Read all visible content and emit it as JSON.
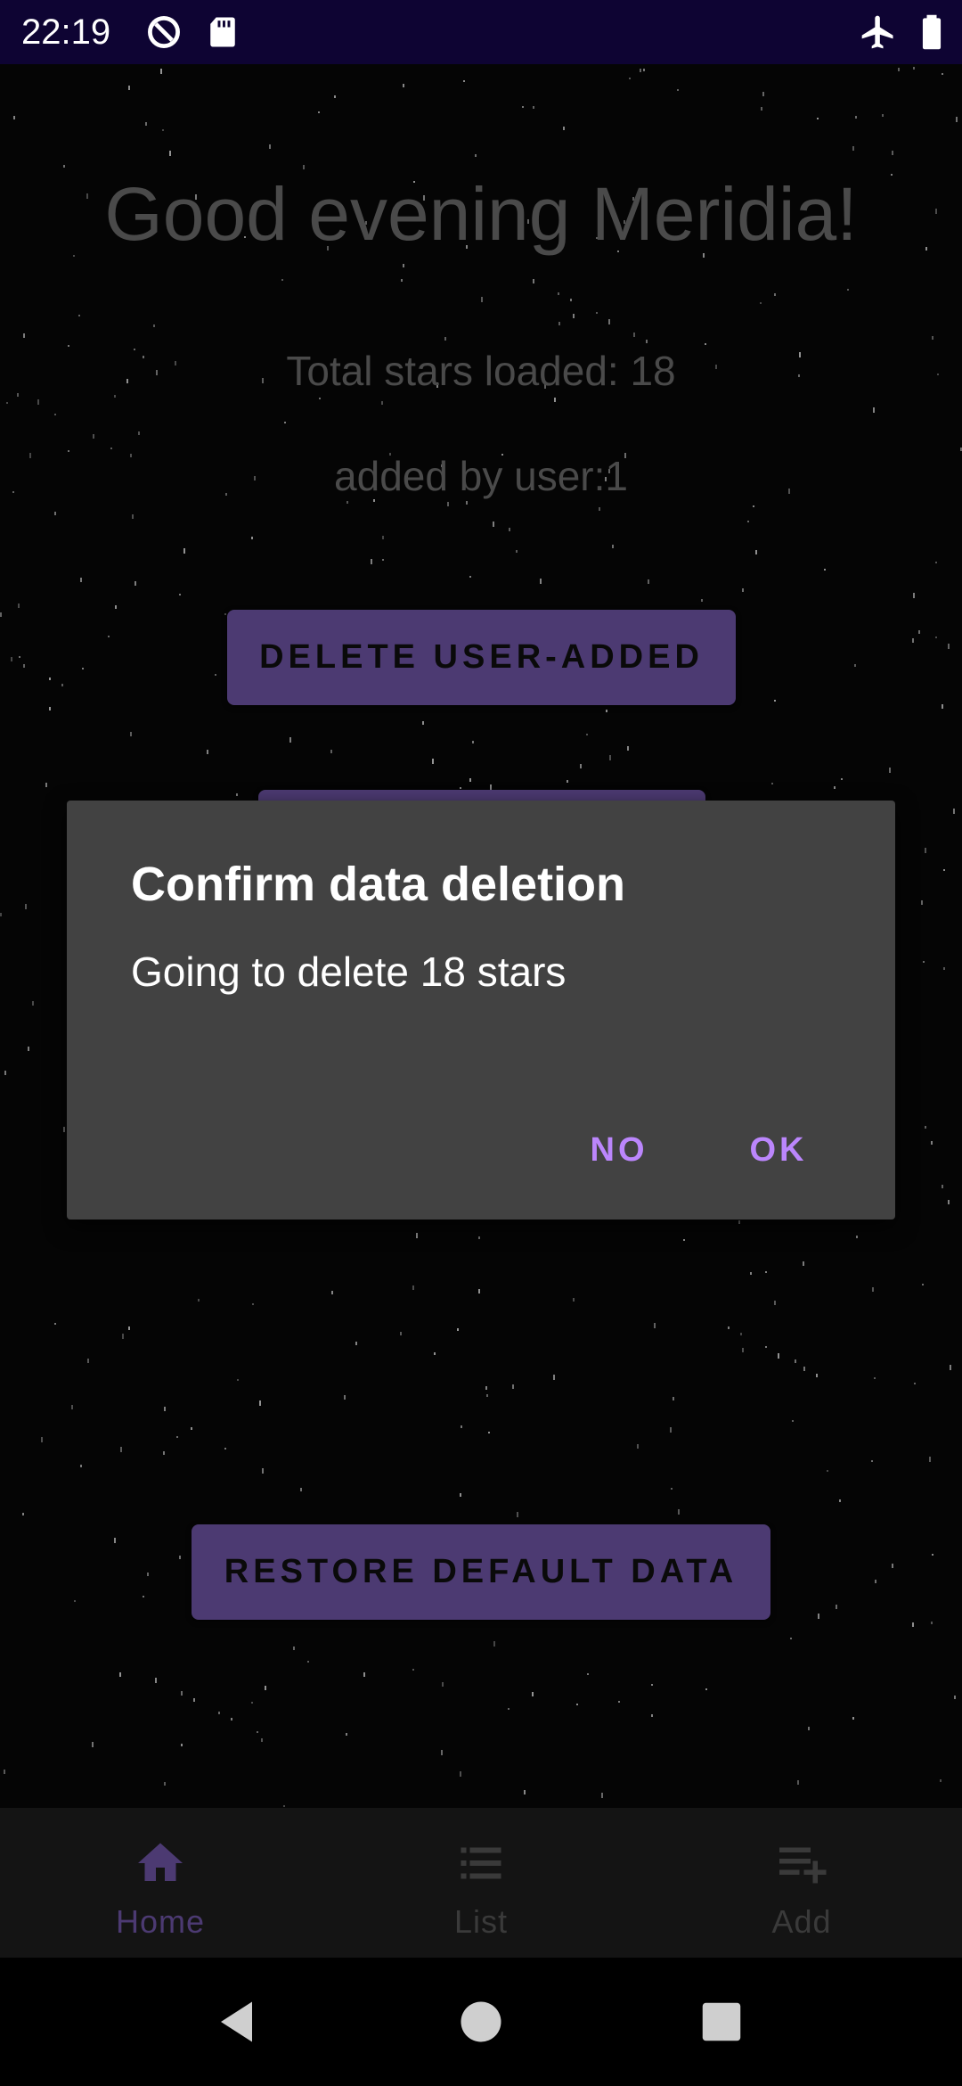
{
  "status_bar": {
    "time": "22:19",
    "left_icons": [
      "data-saver-icon",
      "sd-card-icon"
    ],
    "right_icons": [
      "airplane-mode-icon",
      "battery-icon"
    ],
    "background": "#0e0433"
  },
  "home": {
    "greeting": "Good evening Meridia!",
    "total_stars": "Total stars loaded: 18",
    "added_by_user": "added by user:1",
    "delete_user_added_button": "DELETE USER-ADDED",
    "restore_default_button": "RESTORE DEFAULT DATA"
  },
  "dialog": {
    "title": "Confirm data deletion",
    "message": "Going to delete 18 stars",
    "negative_label": "NO",
    "positive_label": "OK",
    "background": "#424242",
    "action_color": "#bb86fc"
  },
  "bottom_nav": {
    "items": [
      {
        "label": "Home",
        "icon": "home-icon",
        "selected": true
      },
      {
        "label": "List",
        "icon": "list-icon",
        "selected": false
      },
      {
        "label": "Add",
        "icon": "playlist-add-icon",
        "selected": false
      }
    ],
    "selected_color": "#4c3a72",
    "unselected_color": "#3a3a3a"
  },
  "system_nav": {
    "buttons": [
      "back-icon",
      "home-circle-icon",
      "recents-icon"
    ]
  },
  "colors": {
    "accent": "#4c3a72",
    "background": "#050505"
  }
}
